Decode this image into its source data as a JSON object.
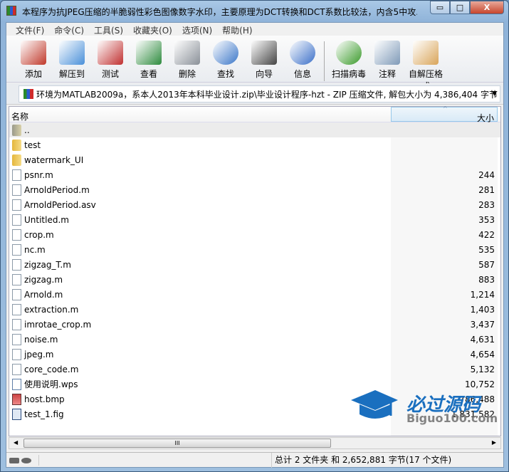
{
  "window": {
    "title": "本程序为抗JPEG压缩的半脆弱性彩色图像数字水印，主要原理为DCT转换和DCT系数比较法，内含5中攻...",
    "min": "▭",
    "max": "□",
    "close": "X"
  },
  "menu": [
    "文件(F)",
    "命令(C)",
    "工具(S)",
    "收藏夹(O)",
    "选项(N)",
    "帮助(H)"
  ],
  "toolbar": [
    {
      "label": "添加",
      "icon": "add-archive-icon",
      "color": "#c0392b"
    },
    {
      "label": "解压到",
      "icon": "extract-folder-icon",
      "color": "#4a90d9"
    },
    {
      "label": "测试",
      "icon": "test-clipboard-icon",
      "color": "#c03030"
    },
    {
      "label": "查看",
      "icon": "view-book-icon",
      "color": "#2e8b3e"
    },
    {
      "label": "删除",
      "icon": "trash-icon",
      "color": "#8a9098"
    },
    {
      "label": "查找",
      "icon": "magnifier-icon",
      "color": "#3a76c8"
    },
    {
      "label": "向导",
      "icon": "wizard-wand-icon",
      "color": "#444444"
    },
    {
      "label": "信息",
      "icon": "info-icon",
      "color": "#3a6fc8"
    },
    {
      "label": "扫描病毒",
      "icon": "virus-scan-icon",
      "color": "#3a9a2a"
    },
    {
      "label": "注释",
      "icon": "comment-icon",
      "color": "#7f9ab8"
    },
    {
      "label": "自解压格式",
      "icon": "sfx-box-icon",
      "color": "#d9a55a"
    }
  ],
  "address": {
    "path": "环境为MATLAB2009a，系本人2013年本科毕业设计.zip\\毕业设计程序-hzt - ZIP 压缩文件, 解包大小为 4,386,404 字节",
    "dropdown": "▼"
  },
  "columns": {
    "name": "名称",
    "size": "大小",
    "sort_arrow": "^"
  },
  "files": [
    {
      "name": "..",
      "size": "",
      "type": "up"
    },
    {
      "name": "test",
      "size": "",
      "type": "folder"
    },
    {
      "name": "watermark_UI",
      "size": "",
      "type": "folder"
    },
    {
      "name": "psnr.m",
      "size": "244",
      "type": "file"
    },
    {
      "name": "ArnoldPeriod.m",
      "size": "281",
      "type": "file"
    },
    {
      "name": "ArnoldPeriod.asv",
      "size": "283",
      "type": "file"
    },
    {
      "name": "Untitled.m",
      "size": "353",
      "type": "file"
    },
    {
      "name": "crop.m",
      "size": "422",
      "type": "file"
    },
    {
      "name": "nc.m",
      "size": "535",
      "type": "file"
    },
    {
      "name": "zigzag_T.m",
      "size": "587",
      "type": "file"
    },
    {
      "name": "zigzag.m",
      "size": "883",
      "type": "file"
    },
    {
      "name": "Arnold.m",
      "size": "1,214",
      "type": "file"
    },
    {
      "name": "extraction.m",
      "size": "1,403",
      "type": "file"
    },
    {
      "name": "imrotae_crop.m",
      "size": "3,437",
      "type": "file"
    },
    {
      "name": "noise.m",
      "size": "4,631",
      "type": "file"
    },
    {
      "name": "jpeg.m",
      "size": "4,654",
      "type": "file"
    },
    {
      "name": "core_code.m",
      "size": "5,132",
      "type": "file"
    },
    {
      "name": "使用说明.wps",
      "size": "10,752",
      "type": "doc"
    },
    {
      "name": "host.bmp",
      "size": "786,488",
      "type": "bmp"
    },
    {
      "name": "test_1.fig",
      "size": "1,831,582",
      "type": "fig"
    }
  ],
  "scrollbar": {
    "left": "◀",
    "right": "▶",
    "grip": "III"
  },
  "status": {
    "text": "总计 2 文件夹 和 2,652,881 字节(17 个文件)"
  },
  "watermark": {
    "title": "必过源码",
    "subtitle": "Biguo100.com"
  }
}
